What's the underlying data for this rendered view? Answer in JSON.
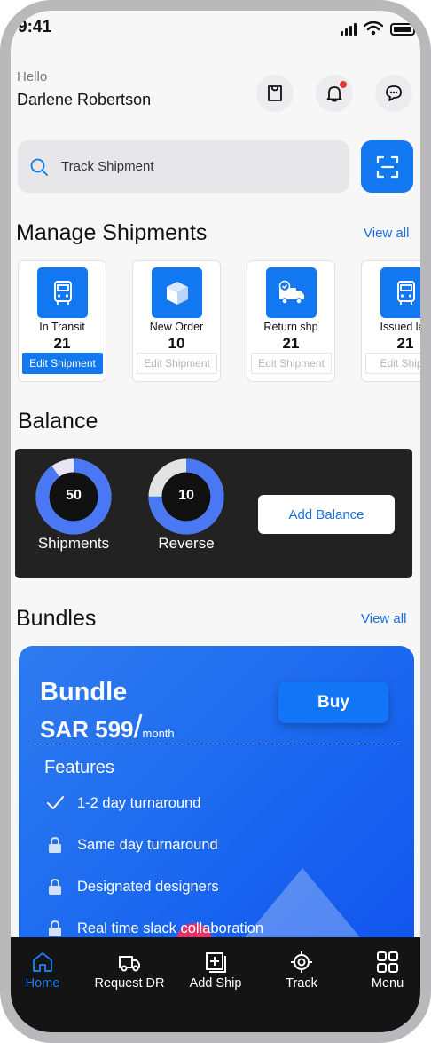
{
  "status_bar": {
    "time": "9:41"
  },
  "header": {
    "greeting": "Hello",
    "user_name": "Darlene Robertson"
  },
  "search": {
    "placeholder": "Track Shipment"
  },
  "manage": {
    "title": "Manage Shipments",
    "view_all": "View all",
    "cards": [
      {
        "label": "In Transit",
        "count": "21",
        "action": "Edit Shipment",
        "icon": "truck-front-icon"
      },
      {
        "label": "New Order",
        "count": "10",
        "action": "Edit Shipment",
        "icon": "box-icon"
      },
      {
        "label": "Return shp",
        "count": "21",
        "action": "Edit Shipment",
        "icon": "delivery-truck-check-icon"
      },
      {
        "label": "Issued lab",
        "count": "21",
        "action": "Edit Shipm",
        "icon": "truck-front-icon"
      }
    ]
  },
  "balance": {
    "title": "Balance",
    "shipments": {
      "value": "50",
      "label": "Shipments",
      "fill": 0.9
    },
    "reverse": {
      "value": "10",
      "label": "Reverse",
      "fill": 0.75
    },
    "add_label": "Add Balance"
  },
  "bundles": {
    "title": "Bundles",
    "view_all": "View all",
    "card": {
      "name": "Bundle",
      "price": "SAR 599",
      "slash": "/",
      "period": "month",
      "buy_label": "Buy",
      "features_title": "Features",
      "features": [
        {
          "text": "1-2 day turnaround",
          "icon": "check-icon"
        },
        {
          "text": "Same  day turnaround",
          "icon": "lock-icon"
        },
        {
          "text": "Designated designers",
          "icon": "lock-icon"
        },
        {
          "text": "Real time slack collaboration",
          "icon": "lock-icon"
        }
      ]
    }
  },
  "nav": {
    "items": [
      {
        "label": "Home",
        "icon": "home-icon",
        "active": true
      },
      {
        "label": "Request DR",
        "icon": "truck-icon"
      },
      {
        "label": "Add Ship",
        "icon": "add-box-icon"
      },
      {
        "label": "Track",
        "icon": "target-icon"
      },
      {
        "label": "Menu",
        "icon": "grid-icon"
      }
    ]
  },
  "colors": {
    "accent": "#1178f2",
    "dark": "#222222",
    "danger": "#e53935"
  }
}
